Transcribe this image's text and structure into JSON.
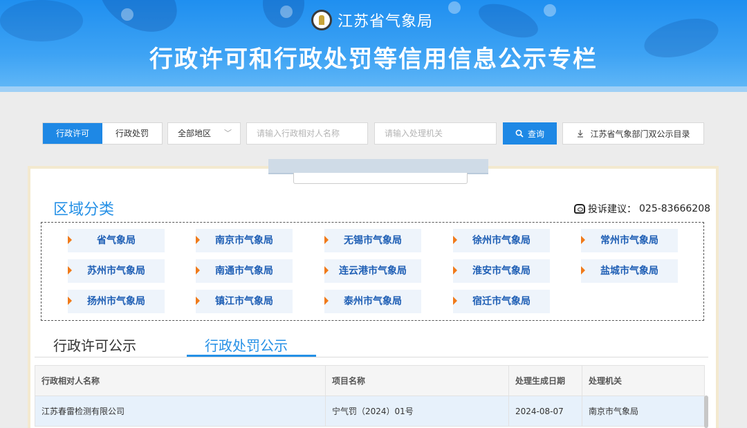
{
  "header": {
    "org_name": "江苏省气象局",
    "headline": "行政许可和行政处罚等信用信息公示专栏",
    "logo_icon": "meteorological-bureau-logo"
  },
  "search": {
    "type_tabs": [
      {
        "label": "行政许可",
        "active": true
      },
      {
        "label": "行政处罚",
        "active": false
      }
    ],
    "region_select": "全部地区",
    "name_placeholder": "请输入行政相对人名称",
    "authority_placeholder": "请输入处理机关",
    "query_label": "查询",
    "catalog_label": "江苏省气象部门双公示目录"
  },
  "regions": {
    "title": "区域分类",
    "complaint_label": "投诉建议：",
    "complaint_phone": "025-83666208",
    "items": [
      "省气象局",
      "南京市气象局",
      "无锡市气象局",
      "徐州市气象局",
      "常州市气象局",
      "苏州市气象局",
      "南通市气象局",
      "连云港市气象局",
      "淮安市气象局",
      "盐城市气象局",
      "扬州市气象局",
      "镇江市气象局",
      "泰州市气象局",
      "宿迁市气象局"
    ]
  },
  "notice_tabs": [
    {
      "label": "行政许可公示",
      "active": false
    },
    {
      "label": "行政处罚公示",
      "active": true
    }
  ],
  "table": {
    "columns": [
      "行政相对人名称",
      "项目名称",
      "处理生成日期",
      "处理机关"
    ],
    "rows": [
      [
        "江苏春雷检测有限公司",
        "宁气罚（2024）01号",
        "2024-08-07",
        "南京市气象局"
      ]
    ]
  },
  "colors": {
    "accent": "#1e88e5",
    "region_text": "#1f5fb5",
    "arrow": "#f07a1a"
  }
}
